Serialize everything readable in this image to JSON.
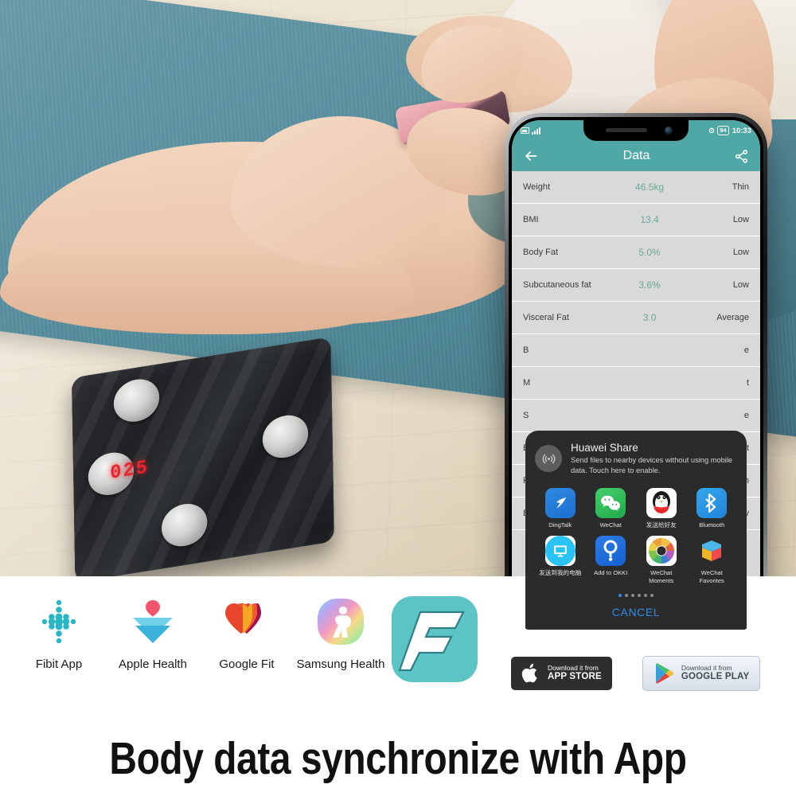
{
  "scale": {
    "led_display": "025"
  },
  "phone": {
    "statusbar": {
      "sim_icon": "sim-card-icon",
      "signal_icon": "signal-bars-icon",
      "alarm_icon": "alarm-icon",
      "battery": "94",
      "time": "10:33"
    },
    "appbar": {
      "back_icon": "back-arrow-icon",
      "title": "Data",
      "share_icon": "share-icon"
    },
    "data_rows": [
      {
        "label": "Weight",
        "value": "46.5kg",
        "status": "Thin"
      },
      {
        "label": "BMI",
        "value": "13.4",
        "status": "Low"
      },
      {
        "label": "Body Fat",
        "value": "5.0%",
        "status": "Low"
      },
      {
        "label": "Subcutaneous fat",
        "value": "3.6%",
        "status": "Low"
      },
      {
        "label": "Visceral Fat",
        "value": "3.0",
        "status": "Average"
      },
      {
        "label": "B",
        "value": "",
        "status": "e"
      },
      {
        "label": "M",
        "value": "",
        "status": "t"
      },
      {
        "label": "S",
        "value": "",
        "status": "e"
      },
      {
        "label": "B",
        "value": "",
        "status": "t"
      },
      {
        "label": "P",
        "value": "",
        "status": "h"
      },
      {
        "label": "B",
        "value": "",
        "status": "v"
      }
    ],
    "share_sheet": {
      "nfc_icon": "nfc-wireless-icon",
      "title": "Huawei Share",
      "description": "Send files to nearby devices without using mobile data. Touch here to enable.",
      "apps": [
        {
          "label": "DingTalk",
          "icon": "dingtalk-icon"
        },
        {
          "label": "WeChat",
          "icon": "wechat-icon"
        },
        {
          "label": "发送给好友",
          "icon": "qq-icon"
        },
        {
          "label": "Bluetooth",
          "icon": "bluetooth-icon"
        },
        {
          "label": "发送到我的电脑",
          "icon": "send-to-pc-icon"
        },
        {
          "label": "Add to OKKI",
          "icon": "okki-icon"
        },
        {
          "label": "WeChat Moments",
          "icon": "wechat-moments-icon"
        },
        {
          "label": "WeChat Favorites",
          "icon": "wechat-favorites-icon"
        }
      ],
      "page_dots": 6,
      "active_dot": 1,
      "cancel_label": "CANCEL"
    }
  },
  "bottom": {
    "app_logos": [
      {
        "name": "Fibit App",
        "icon": "fitbit-logo"
      },
      {
        "name": "Apple Health",
        "icon": "apple-health-logo"
      },
      {
        "name": "Google Fit",
        "icon": "google-fit-logo"
      },
      {
        "name": "Samsung Health",
        "icon": "samsung-health-logo"
      },
      {
        "name": "",
        "icon": "fitdays-f-logo"
      }
    ],
    "badges": [
      {
        "icon": "apple-icon",
        "small": "Download it from",
        "large": "APP STORE"
      },
      {
        "icon": "google-play-icon",
        "small": "Download it from",
        "large": "GOOGLE PLAY"
      }
    ],
    "headline": "Body data synchronize with App"
  },
  "colors": {
    "teal_header": "#4fa8a6",
    "value_green": "#6aa79a",
    "cancel_blue": "#2d8bea",
    "sheet_dark": "#2b2b2b",
    "led_red": "#e8262c"
  }
}
